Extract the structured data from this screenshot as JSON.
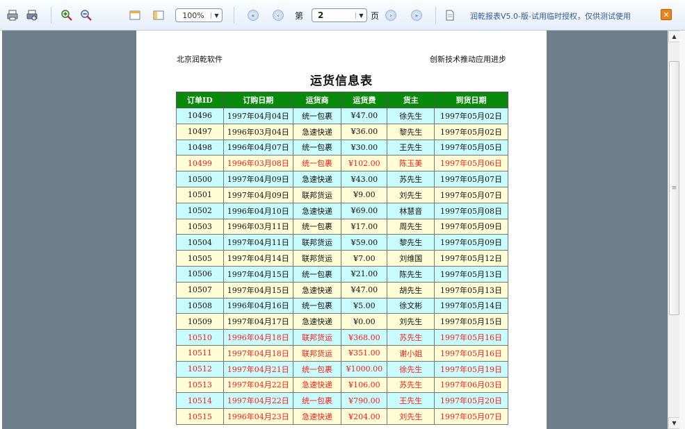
{
  "toolbar": {
    "zoom": "100%",
    "page_prefix": "第",
    "page_value": "2",
    "page_suffix": "页",
    "trial_notice": "润乾报表V5.0-版-试用临时授权，仅供测试使用",
    "close_label": "✕",
    "icons": [
      "print-icon",
      "print-preview-icon",
      "zoom-in-icon",
      "zoom-out-icon",
      "page-width-icon",
      "page-setup-icon",
      "first-page-icon",
      "prev-page-icon",
      "next-page-icon",
      "last-page-icon",
      "export-icon",
      "close-icon"
    ]
  },
  "report": {
    "header_left": "北京润乾软件",
    "header_right": "创新技术推动应用进步",
    "title": "运货信息表",
    "columns": [
      "订单ID",
      "订购日期",
      "运货商",
      "运货费",
      "货主",
      "到货日期"
    ],
    "rows": [
      [
        "10496",
        "1997年04月04日",
        "统一包裹",
        "¥47.00",
        "徐先生",
        "1997年05月02日",
        "cyan",
        false
      ],
      [
        "10497",
        "1996年03月04日",
        "急速快递",
        "¥36.00",
        "黎先生",
        "1997年05月02日",
        "yellow",
        false
      ],
      [
        "10498",
        "1996年04月07日",
        "统一包裹",
        "¥30.00",
        "王先生",
        "1997年05月05日",
        "cyan",
        false
      ],
      [
        "10499",
        "1996年03月08日",
        "统一包裹",
        "¥102.00",
        "陈玉美",
        "1997年05月06日",
        "yellow",
        true
      ],
      [
        "10500",
        "1997年04月09日",
        "急速快递",
        "¥43.00",
        "苏先生",
        "1997年05月07日",
        "cyan",
        false
      ],
      [
        "10501",
        "1997年04月09日",
        "联邦货运",
        "¥9.00",
        "刘先生",
        "1997年05月07日",
        "yellow",
        false
      ],
      [
        "10502",
        "1996年04月10日",
        "急速快递",
        "¥69.00",
        "林慧音",
        "1997年05月08日",
        "cyan",
        false
      ],
      [
        "10503",
        "1996年03月11日",
        "统一包裹",
        "¥17.00",
        "周先生",
        "1997年05月09日",
        "yellow",
        false
      ],
      [
        "10504",
        "1997年04月11日",
        "联邦货运",
        "¥59.00",
        "黎先生",
        "1997年05月09日",
        "cyan",
        false
      ],
      [
        "10505",
        "1997年04月14日",
        "联邦货运",
        "¥7.00",
        "刘维国",
        "1997年05月12日",
        "yellow",
        false
      ],
      [
        "10506",
        "1997年04月15日",
        "统一包裹",
        "¥21.00",
        "陈先生",
        "1997年05月13日",
        "cyan",
        false
      ],
      [
        "10507",
        "1997年04月15日",
        "急速快递",
        "¥47.00",
        "胡先生",
        "1997年05月13日",
        "yellow",
        false
      ],
      [
        "10508",
        "1996年04月16日",
        "统一包裹",
        "¥5.00",
        "徐文彬",
        "1997年05月14日",
        "cyan",
        false
      ],
      [
        "10509",
        "1997年04月17日",
        "急速快递",
        "¥0.00",
        "刘先生",
        "1997年05月15日",
        "yellow",
        false
      ],
      [
        "10510",
        "1996年04月18日",
        "联邦货运",
        "¥368.00",
        "苏先生",
        "1997年05月16日",
        "cyan",
        true
      ],
      [
        "10511",
        "1997年04月18日",
        "联邦货运",
        "¥351.00",
        "谢小姐",
        "1997年05月16日",
        "yellow",
        true
      ],
      [
        "10512",
        "1997年04月21日",
        "统一包裹",
        "¥1000.00",
        "徐先生",
        "1997年05月19日",
        "cyan",
        true
      ],
      [
        "10513",
        "1997年04月22日",
        "急速快递",
        "¥106.00",
        "苏先生",
        "1997年06月03日",
        "yellow",
        true
      ],
      [
        "10514",
        "1997年04月22日",
        "统一包裹",
        "¥790.00",
        "王先生",
        "1997年05月20日",
        "cyan",
        true
      ],
      [
        "10515",
        "1996年04月23日",
        "急速快递",
        "¥204.00",
        "刘先生",
        "1997年05月07日",
        "yellow",
        true
      ]
    ]
  }
}
